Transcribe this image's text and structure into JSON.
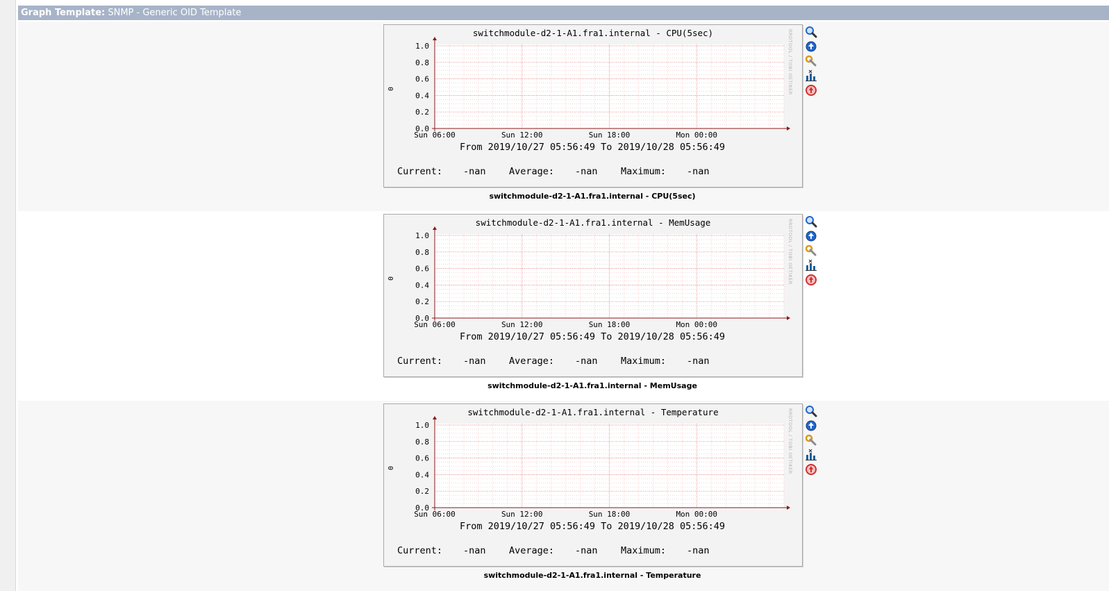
{
  "header": {
    "label": "Graph Template:",
    "template_name": "SNMP - Generic OID Template"
  },
  "icons": [
    "zoom-icon",
    "time-graph-icon",
    "properties-icon",
    "csv-export-icon",
    "spike-kill-icon"
  ],
  "graphs": [
    {
      "title": "switchmodule-d2-1-A1.fra1.internal - CPU(5sec)",
      "caption": "switchmodule-d2-1-A1.fra1.internal - CPU(5sec)",
      "ylabel": "0",
      "watermark": "RRDTOOL / TOBI OETIKER",
      "date_range": "From 2019/10/27 05:56:49 To 2019/10/28 05:56:49",
      "legend": {
        "current_label": "Current:",
        "current_value": "-nan",
        "average_label": "Average:",
        "average_value": "-nan",
        "maximum_label": "Maximum:",
        "maximum_value": "-nan"
      }
    },
    {
      "title": "switchmodule-d2-1-A1.fra1.internal - MemUsage",
      "caption": "switchmodule-d2-1-A1.fra1.internal - MemUsage",
      "ylabel": "0",
      "watermark": "RRDTOOL / TOBI OETIKER",
      "date_range": "From 2019/10/27 05:56:49 To 2019/10/28 05:56:49",
      "legend": {
        "current_label": "Current:",
        "current_value": "-nan",
        "average_label": "Average:",
        "average_value": "-nan",
        "maximum_label": "Maximum:",
        "maximum_value": "-nan"
      }
    },
    {
      "title": "switchmodule-d2-1-A1.fra1.internal - Temperature",
      "caption": "switchmodule-d2-1-A1.fra1.internal - Temperature",
      "ylabel": "0",
      "watermark": "RRDTOOL / TOBI OETIKER",
      "date_range": "From 2019/10/27 05:56:49 To 2019/10/28 05:56:49",
      "legend": {
        "current_label": "Current:",
        "current_value": "-nan",
        "average_label": "Average:",
        "average_value": "-nan",
        "maximum_label": "Maximum:",
        "maximum_value": "-nan"
      }
    }
  ],
  "chart_data": [
    {
      "type": "line",
      "title": "switchmodule-d2-1-A1.fra1.internal - CPU(5sec)",
      "xlabel": "",
      "ylabel": "0",
      "x_ticks": [
        "Sun 06:00",
        "Sun 12:00",
        "Sun 18:00",
        "Mon 00:00"
      ],
      "y_ticks": [
        "0.0",
        "0.2",
        "0.4",
        "0.6",
        "0.8",
        "1.0"
      ],
      "ylim": [
        0,
        1.0
      ],
      "grid": true,
      "series": []
    },
    {
      "type": "line",
      "title": "switchmodule-d2-1-A1.fra1.internal - MemUsage",
      "xlabel": "",
      "ylabel": "0",
      "x_ticks": [
        "Sun 06:00",
        "Sun 12:00",
        "Sun 18:00",
        "Mon 00:00"
      ],
      "y_ticks": [
        "0.0",
        "0.2",
        "0.4",
        "0.6",
        "0.8",
        "1.0"
      ],
      "ylim": [
        0,
        1.0
      ],
      "grid": true,
      "series": []
    },
    {
      "type": "line",
      "title": "switchmodule-d2-1-A1.fra1.internal - Temperature",
      "xlabel": "",
      "ylabel": "0",
      "x_ticks": [
        "Sun 06:00",
        "Sun 12:00",
        "Sun 18:00",
        "Mon 00:00"
      ],
      "y_ticks": [
        "0.0",
        "0.2",
        "0.4",
        "0.6",
        "0.8",
        "1.0"
      ],
      "ylim": [
        0,
        1.0
      ],
      "grid": true,
      "series": []
    }
  ],
  "colors": {
    "header_bg": "#a7b4c8",
    "grid_minor": "#f2b8b8",
    "grid_major": "#e89090",
    "axis": "#8b1a1a",
    "zoom": "#2266cc",
    "time": "#2266cc",
    "properties": "#d99a1a",
    "export": "#1a5f9a",
    "spike": "#d03030"
  }
}
